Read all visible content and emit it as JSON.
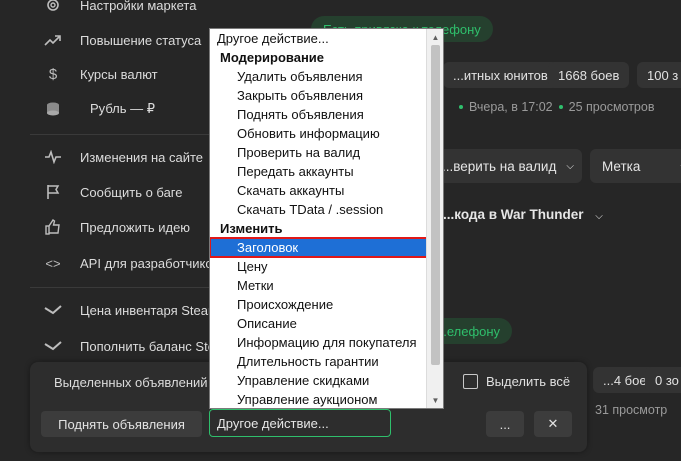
{
  "sidebar": {
    "items": [
      {
        "icon": "gear-icon",
        "label": "Настройки маркета"
      },
      {
        "icon": "trending-up-icon",
        "label": "Повышение статуса"
      },
      {
        "icon": "dollar-icon",
        "label": "Курсы валют"
      },
      {
        "icon": "coins-icon",
        "label": "Рубль — ₽"
      },
      {
        "icon": "pulse-icon",
        "label": "Изменения на сайте"
      },
      {
        "icon": "flag-icon",
        "label": "Сообщить о баге"
      },
      {
        "icon": "thumbs-up-icon",
        "label": "Предложить идею"
      },
      {
        "icon": "code-icon",
        "label": "API для разработчиков"
      },
      {
        "icon": "steam-icon",
        "label": "Цена инвентаря Steam"
      },
      {
        "icon": "steam-icon",
        "label": "Пополнить баланс Steam"
      }
    ]
  },
  "listing1": {
    "badge": "Есть привязка к телефону",
    "chips": [
      "...итных юнитов",
      "1668 боев",
      "100 з"
    ],
    "meta_date": "Вчера, в 17:02",
    "meta_views": "25 просмотров",
    "check_select": "...верить на валид",
    "tag_select": "Метка",
    "title": "...кода в War Thunder"
  },
  "listing2": {
    "badge": "...елефону",
    "chips": [
      "...4 боев",
      "0 зо"
    ],
    "meta_views": "31 просмотр"
  },
  "action_bar": {
    "selected_label": "Выделенных объявлений",
    "select_all_label": "Выделить всё",
    "bump_button": "Поднять объявления",
    "action_select_value": "Другое действие...",
    "more_button": "...",
    "close_button": "✕"
  },
  "dropdown": {
    "options": [
      {
        "kind": "top",
        "label": "Другое действие..."
      },
      {
        "kind": "group",
        "label": "Модерирование"
      },
      {
        "kind": "sub",
        "label": "Удалить объявления"
      },
      {
        "kind": "sub",
        "label": "Закрыть объявления"
      },
      {
        "kind": "sub",
        "label": "Поднять объявления"
      },
      {
        "kind": "sub",
        "label": "Обновить информацию"
      },
      {
        "kind": "sub",
        "label": "Проверить на валид"
      },
      {
        "kind": "sub",
        "label": "Передать аккаунты"
      },
      {
        "kind": "sub",
        "label": "Скачать аккаунты"
      },
      {
        "kind": "sub",
        "label": "Скачать TData / .session"
      },
      {
        "kind": "group",
        "label": "Изменить"
      },
      {
        "kind": "sub",
        "label": "Заголовок",
        "selected": true
      },
      {
        "kind": "sub",
        "label": "Цену"
      },
      {
        "kind": "sub",
        "label": "Метки"
      },
      {
        "kind": "sub",
        "label": "Происхождение"
      },
      {
        "kind": "sub",
        "label": "Описание"
      },
      {
        "kind": "sub",
        "label": "Информацию для покупателя"
      },
      {
        "kind": "sub",
        "label": "Длительность гарантии"
      },
      {
        "kind": "sub",
        "label": "Управление скидками"
      },
      {
        "kind": "sub",
        "label": "Управление аукционом"
      }
    ]
  },
  "colors": {
    "accent_green": "#2fbf6c",
    "selection_blue": "#1e6fd6",
    "highlight_red": "#e01818"
  }
}
